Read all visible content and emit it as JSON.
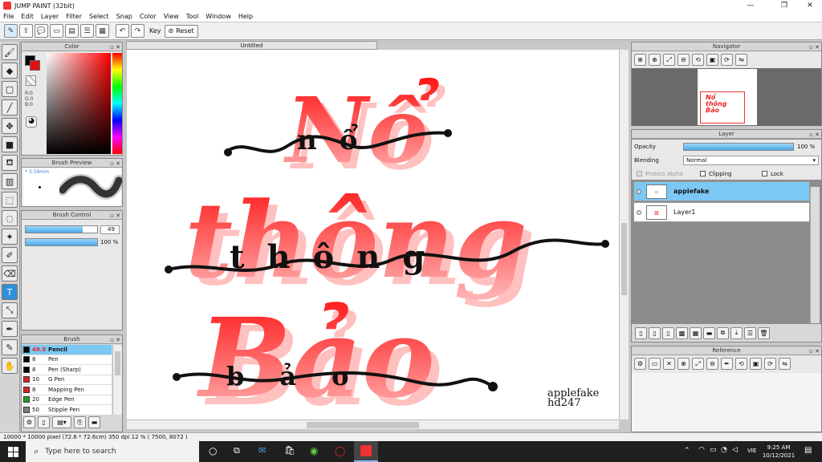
{
  "app": {
    "title": "JUMP PAINT (32bit)"
  },
  "menu": [
    "File",
    "Edit",
    "Layer",
    "Filter",
    "Select",
    "Snap",
    "Color",
    "View",
    "Tool",
    "Window",
    "Help"
  ],
  "toolbar": {
    "key_label": "Key",
    "reset_label": "Reset"
  },
  "color_panel": {
    "title": "Color",
    "r": "R:0",
    "g": "G:0",
    "b": "B:0",
    "fg": "#000000",
    "bg": "#e01010"
  },
  "brush_preview": {
    "title": "Brush Preview",
    "size": "* 3.59mm"
  },
  "brush_control": {
    "title": "Brush Control",
    "size_value": "49",
    "opacity_value": "100 %",
    "size_fill": 0.8,
    "opacity_fill": 1.0
  },
  "brush_panel": {
    "title": "Brush",
    "items": [
      {
        "size": "49.5",
        "name": "Pencil",
        "color": "#000000",
        "selected": true
      },
      {
        "size": "8",
        "name": "Pen",
        "color": "#000000"
      },
      {
        "size": "8",
        "name": "Pen (Sharp)",
        "color": "#000000"
      },
      {
        "size": "10",
        "name": "G Pen",
        "color": "#e02020"
      },
      {
        "size": "8",
        "name": "Mapping Pen",
        "color": "#e02020"
      },
      {
        "size": "20",
        "name": "Edge Pen",
        "color": "#20a020"
      },
      {
        "size": "50",
        "name": "Stipple Pen",
        "color": "#808080"
      }
    ]
  },
  "document": {
    "tab": "Untitled"
  },
  "artwork": {
    "line1": "Nổ",
    "line2": "thông",
    "line3": "Bảo",
    "script1": "nổ",
    "script2": "thông",
    "script3": "bảo",
    "signature1": "applefake",
    "signature2": "hd247",
    "red": "#ff1a1a",
    "pink": "#ffb0b0"
  },
  "navigator": {
    "title": "Navigator"
  },
  "layer_panel": {
    "title": "Layer",
    "opacity_label": "Opacity",
    "opacity_value": "100 %",
    "blending_label": "Blending",
    "blending_value": "Normal",
    "protect_alpha": "Protect Alpha",
    "clipping": "Clipping",
    "lock": "Lock",
    "layers": [
      {
        "name": "applefake",
        "selected": true
      },
      {
        "name": "Layer1",
        "selected": false
      }
    ]
  },
  "reference": {
    "title": "Reference"
  },
  "status": {
    "text": "10000 * 10000 pixel   (72.6 * 72.6cm)   350 dpi   12 %   ( 7500, 8072 )"
  },
  "taskbar": {
    "search_placeholder": "Type here to search",
    "time": "9:25 AM",
    "date": "10/12/2021",
    "lang": "VIE"
  }
}
